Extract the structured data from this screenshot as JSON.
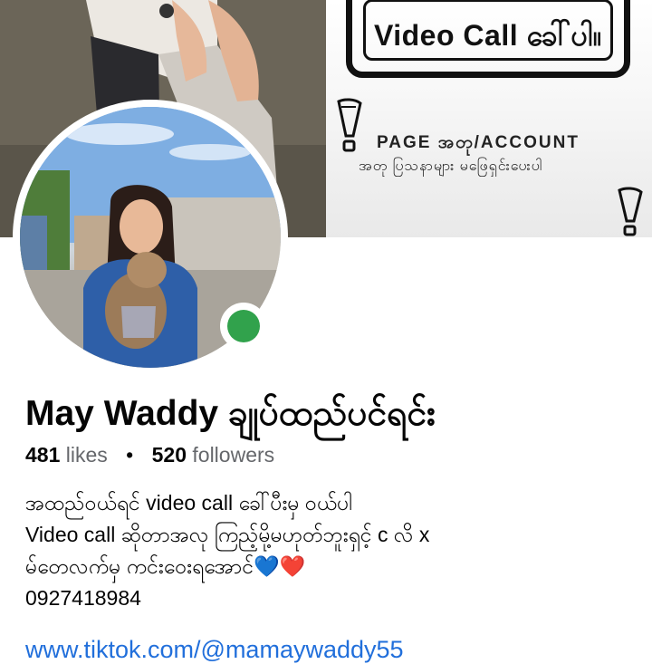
{
  "cover": {
    "banner_text": "Video Call ခေါ်ပါ။",
    "notice_line1": "PAGE အတု/ACCOUNT",
    "notice_line2": "အတု ပြသနာများ မဖြေရှင်းပေးပါ"
  },
  "profile": {
    "name": "May Waddy ချုပ်ထည်ပင်ရင်း",
    "likes_count": "481",
    "likes_label": "likes",
    "separator": "•",
    "followers_count": "520",
    "followers_label": "followers",
    "bio_lines": [
      "အထည်ဝယ်ရင် video call ခေါ်ပီးမှ ဝယ်ပါ",
      "Video call ဆိုတာအလု ကြည့်မို့မဟုတ်ဘူးရှင့် c လိ x",
      "မ်တေလက်မှ ကင်းဝေးရအောင်💙❤️",
      "0927418984"
    ],
    "link": "www.tiktok.com/@mamaywaddy55"
  },
  "colors": {
    "online": "#31a24c",
    "link": "#216fdb",
    "muted": "#65676b"
  }
}
